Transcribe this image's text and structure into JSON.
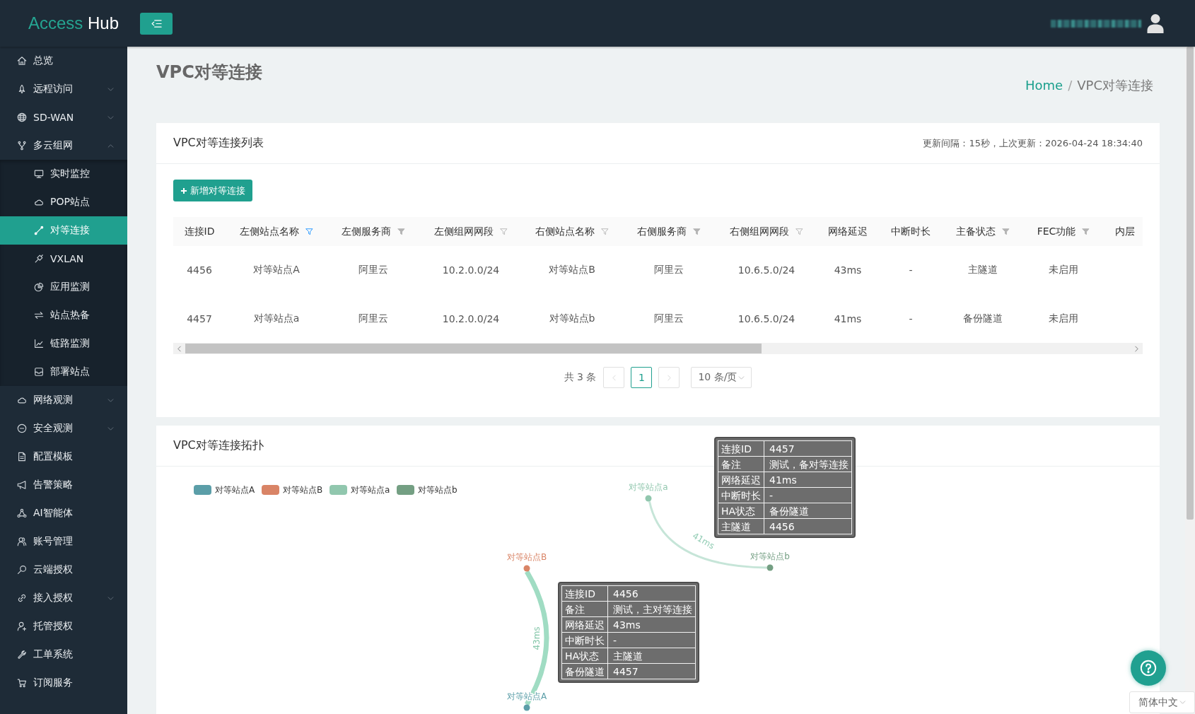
{
  "header": {
    "logo": {
      "prefix": "Access",
      "suffix": "Hub"
    }
  },
  "sidebar": {
    "items": [
      {
        "label": "总览",
        "kind": "link",
        "selected": false
      },
      {
        "label": "远程访问",
        "kind": "group",
        "expanded": false,
        "selected": false
      },
      {
        "label": "SD-WAN",
        "kind": "group",
        "expanded": false,
        "selected": false
      },
      {
        "label": "多云组网",
        "kind": "group",
        "expanded": true,
        "selected": false,
        "children": [
          {
            "label": "实时监控",
            "selected": false
          },
          {
            "label": "POP站点",
            "selected": false
          },
          {
            "label": "对等连接",
            "selected": true
          },
          {
            "label": "VXLAN",
            "selected": false
          },
          {
            "label": "应用监测",
            "selected": false
          },
          {
            "label": "站点热备",
            "selected": false
          },
          {
            "label": "链路监测",
            "selected": false
          },
          {
            "label": "部署站点",
            "selected": false
          }
        ]
      },
      {
        "label": "网络观测",
        "kind": "group",
        "expanded": false,
        "selected": false
      },
      {
        "label": "安全观测",
        "kind": "group",
        "expanded": false,
        "selected": false
      },
      {
        "label": "配置模板",
        "kind": "link",
        "selected": false
      },
      {
        "label": "告警策略",
        "kind": "link",
        "selected": false
      },
      {
        "label": "AI智能体",
        "kind": "link",
        "selected": false
      },
      {
        "label": "账号管理",
        "kind": "link",
        "selected": false
      },
      {
        "label": "云端授权",
        "kind": "link",
        "selected": false
      },
      {
        "label": "接入授权",
        "kind": "group",
        "expanded": false,
        "selected": false
      },
      {
        "label": "托管授权",
        "kind": "link",
        "selected": false
      },
      {
        "label": "工单系统",
        "kind": "link",
        "selected": false
      },
      {
        "label": "订阅服务",
        "kind": "link",
        "selected": false
      }
    ]
  },
  "page": {
    "title": "VPC对等连接",
    "breadcrumb": {
      "items": [
        "Home",
        "VPC对等连接"
      ],
      "separator": "/"
    }
  },
  "list_card": {
    "title": "VPC对等连接列表",
    "refresh_info": "更新间隔：15秒，上次更新：2026-04-24 18:34:40",
    "add_button": "新增对等连接",
    "table": {
      "columns": [
        {
          "label": "连接ID",
          "kind": "plain"
        },
        {
          "label": "左侧站点名称",
          "kind": "outlined",
          "filtered": true
        },
        {
          "label": "左侧服务商",
          "kind": "solid",
          "filtered": false
        },
        {
          "label": "左侧组网网段",
          "kind": "outlined",
          "filtered": false
        },
        {
          "label": "右侧站点名称",
          "kind": "outlined",
          "filtered": false
        },
        {
          "label": "右侧服务商",
          "kind": "solid",
          "filtered": false
        },
        {
          "label": "右侧组网网段",
          "kind": "outlined",
          "filtered": false
        },
        {
          "label": "网络延迟",
          "kind": "plain"
        },
        {
          "label": "中断时长",
          "kind": "plain"
        },
        {
          "label": "主备状态",
          "kind": "solid",
          "filtered": false
        },
        {
          "label": "FEC功能",
          "kind": "solid",
          "filtered": false
        },
        {
          "label": "内层",
          "kind": "plain"
        }
      ],
      "rows": [
        {
          "cells": [
            "4456",
            "对等站点A",
            "阿里云",
            "10.2.0.0/24",
            "对等站点B",
            "阿里云",
            "10.6.5.0/24",
            "43ms",
            "-",
            "主隧道",
            "未启用"
          ]
        },
        {
          "cells": [
            "4457",
            "对等站点a",
            "阿里云",
            "10.2.0.0/24",
            "对等站点b",
            "阿里云",
            "10.6.5.0/24",
            "41ms",
            "-",
            "备份隧道",
            "未启用"
          ]
        }
      ]
    },
    "pagination": {
      "total": "共 3 条",
      "prev_disabled": true,
      "pages": [
        {
          "label": "1",
          "selected": true
        }
      ],
      "next_disabled": true,
      "page_size": "10 条/页"
    }
  },
  "topology_card": {
    "title": "VPC对等连接拓扑",
    "legend": [
      {
        "label": "对等站点A",
        "color": "#5b9ea8"
      },
      {
        "label": "对等站点B",
        "color": "#d98466"
      },
      {
        "label": "对等站点a",
        "color": "#91c7ae"
      },
      {
        "label": "对等站点b",
        "color": "#749f83"
      }
    ],
    "nodes": [
      {
        "label": "对等站点A",
        "color": "#5b9ea8"
      },
      {
        "label": "对等站点B",
        "color": "#d98466"
      },
      {
        "label": "对等站点a",
        "color": "#91c7ae"
      },
      {
        "label": "对等站点b",
        "color": "#749f83"
      }
    ],
    "edges": [
      {
        "label": "43ms",
        "kind": "primary"
      },
      {
        "label": "41ms",
        "kind": "backup"
      }
    ],
    "tooltips": [
      {
        "rows": [
          {
            "cells": [
              "连接ID",
              "4457"
            ]
          },
          {
            "cells": [
              "备注",
              "测试，备对等连接"
            ]
          },
          {
            "cells": [
              "网络延迟",
              "41ms"
            ]
          },
          {
            "cells": [
              "中断时长",
              "-"
            ]
          },
          {
            "cells": [
              "HA状态",
              "备份隧道"
            ]
          },
          {
            "cells": [
              "主隧道",
              "4456"
            ]
          }
        ]
      },
      {
        "rows": [
          {
            "cells": [
              "连接ID",
              "4456"
            ]
          },
          {
            "cells": [
              "备注",
              "测试，主对等连接"
            ]
          },
          {
            "cells": [
              "网络延迟",
              "43ms"
            ]
          },
          {
            "cells": [
              "中断时长",
              "-"
            ]
          },
          {
            "cells": [
              "HA状态",
              "主隧道"
            ]
          },
          {
            "cells": [
              "备份隧道",
              "4457"
            ]
          }
        ]
      }
    ]
  },
  "language_select": {
    "value": "简体中文"
  }
}
